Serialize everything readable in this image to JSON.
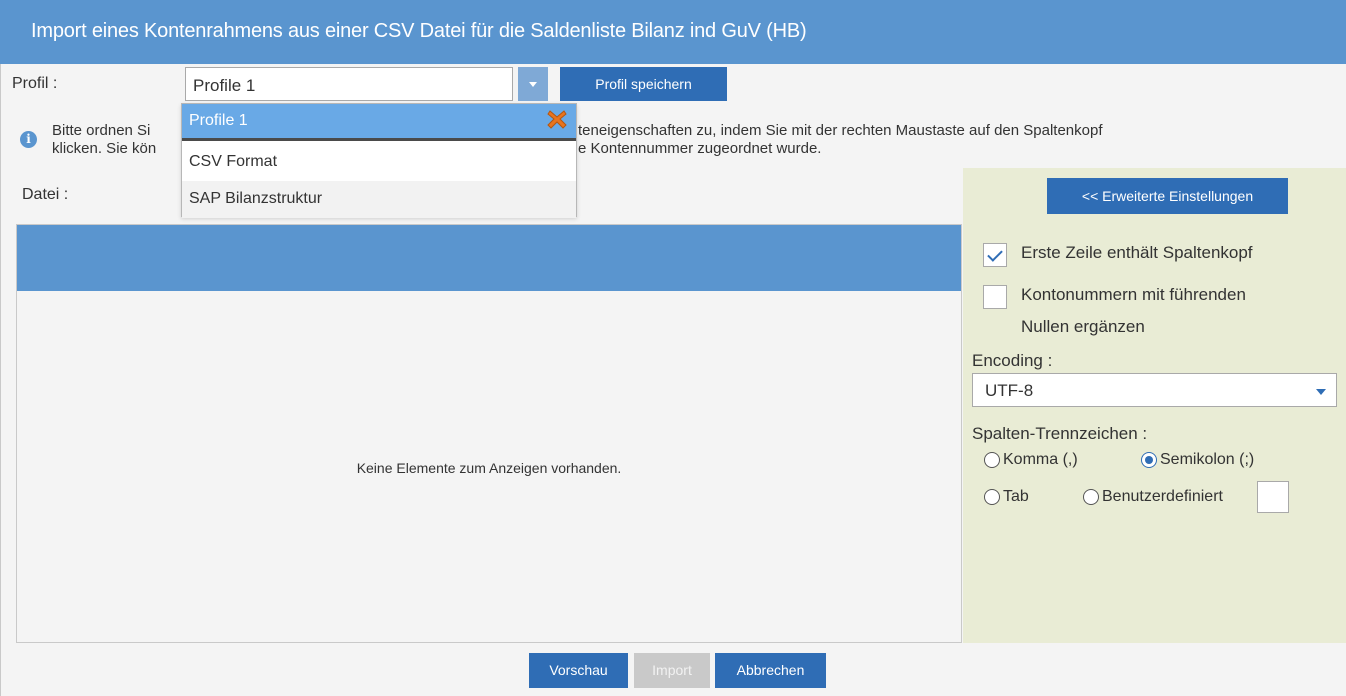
{
  "window": {
    "title": "Import eines Kontenrahmens aus einer CSV Datei für die Saldenliste Bilanz ind GuV (HB)"
  },
  "profile": {
    "label": "Profil :",
    "selected": "Profile 1",
    "save_button": "Profil speichern",
    "dropdown_items": [
      {
        "label": "Profile 1",
        "selected": true
      },
      {
        "label": "CSV Format",
        "selected": false
      },
      {
        "label": "SAP Bilanzstruktur",
        "selected": false
      }
    ]
  },
  "info": {
    "line1_start": "Bitte ordnen Si",
    "line1_end": "teneigenschaften zu, indem Sie mit der rechten Maustaste auf den Spaltenkopf",
    "line2_start": "klicken. Sie kön",
    "line2_end": "e Kontennummer zugeordnet wurde."
  },
  "file": {
    "label": "Datei :"
  },
  "grid": {
    "empty_text": "Keine Elemente zum Anzeigen vorhanden."
  },
  "settings": {
    "toggle_button": "<< Erweiterte Einstellungen",
    "first_row_header": {
      "label": "Erste Zeile enthält Spaltenkopf",
      "checked": true
    },
    "leading_zeros": {
      "label_line1": "Kontonummern mit führenden",
      "label_line2": "Nullen ergänzen",
      "checked": false
    },
    "encoding": {
      "label": "Encoding :",
      "value": "UTF-8"
    },
    "separator": {
      "label": "Spalten-Trennzeichen :",
      "options": [
        {
          "label": "Komma (,)",
          "checked": false
        },
        {
          "label": "Semikolon (;)",
          "checked": true
        },
        {
          "label": "Tab",
          "checked": false
        },
        {
          "label": "Benutzerdefiniert",
          "checked": false
        }
      ]
    }
  },
  "footer": {
    "preview": "Vorschau",
    "import": "Import",
    "cancel": "Abbrechen"
  },
  "colors": {
    "header_blue": "#5a95cf",
    "button_blue": "#2f6db5",
    "panel_bg": "#e9ecd5",
    "dropdown_highlight": "#69a9e6"
  }
}
